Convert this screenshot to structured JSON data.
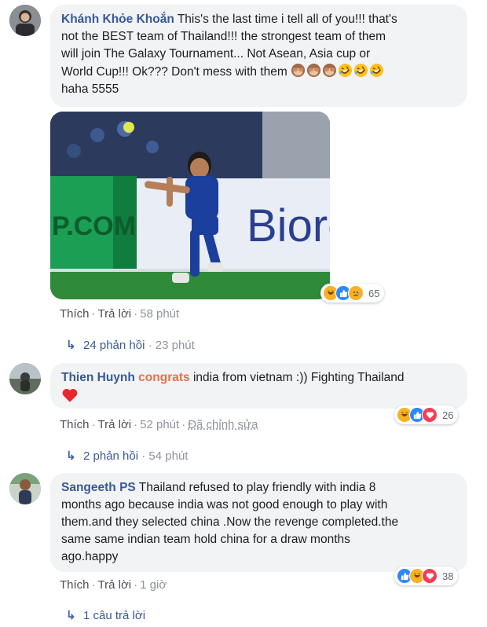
{
  "comments": [
    {
      "author": "Khánh Khỏe Khoắn",
      "text_line1": " This's the last time i tell all of you!!! that's",
      "text_line2": "not the BEST team of Thailand!!! the strongest team of them",
      "text_line3": "will join The Galaxy Tournament... Not Asean, Asia cup or",
      "text_line4": "World Cup!!! Ok??? Don't mess with them",
      "text_line5": "haha 5555",
      "emojis": [
        "see-no-evil-monkey",
        "see-no-evil-monkey",
        "see-no-evil-monkey",
        "rolling-laughing",
        "rolling-laughing",
        "rolling-laughing"
      ],
      "photo_board_text_left": "P.COM",
      "photo_board_text_right": "Bioré",
      "reaction_icons": [
        "haha",
        "like",
        "sad"
      ],
      "reaction_count": "65",
      "like_label": "Thích",
      "reply_label": "Trả lời",
      "time": "58 phút",
      "replies_label": "24 phản hồi",
      "replies_time": "23 phút"
    },
    {
      "author": "Thien Huynh",
      "tag": "congrats",
      "text_line1": " india from vietnam :)) Fighting Thailand",
      "emojis": [
        "red-heart"
      ],
      "reaction_icons": [
        "haha",
        "like",
        "love"
      ],
      "reaction_count": "26",
      "like_label": "Thích",
      "reply_label": "Trả lời",
      "time": "52 phút",
      "edited_label": "Đã chỉnh sửa",
      "replies_label": "2 phản hồi",
      "replies_time": "54 phút"
    },
    {
      "author": "Sangeeth PS",
      "text_line1": " Thailand refused to play friendly with india 8",
      "text_line2": "months ago because india was not good enough to play with",
      "text_line3": "them.and they selected china .Now the revenge completed.the",
      "text_line4": "same same indian team hold china for a draw months",
      "text_line5": "ago.happy",
      "reaction_icons": [
        "like",
        "haha",
        "love"
      ],
      "reaction_count": "38",
      "like_label": "Thích",
      "reply_label": "Trả lời",
      "time": "1 giờ",
      "replies_label": "1 câu trả lời"
    }
  ],
  "colors": {
    "author": "#385898",
    "tag": "#e4704b",
    "bubble": "#f2f3f5",
    "like": "#2d88ff",
    "love": "#f33e58",
    "haha": "#f7b125"
  }
}
